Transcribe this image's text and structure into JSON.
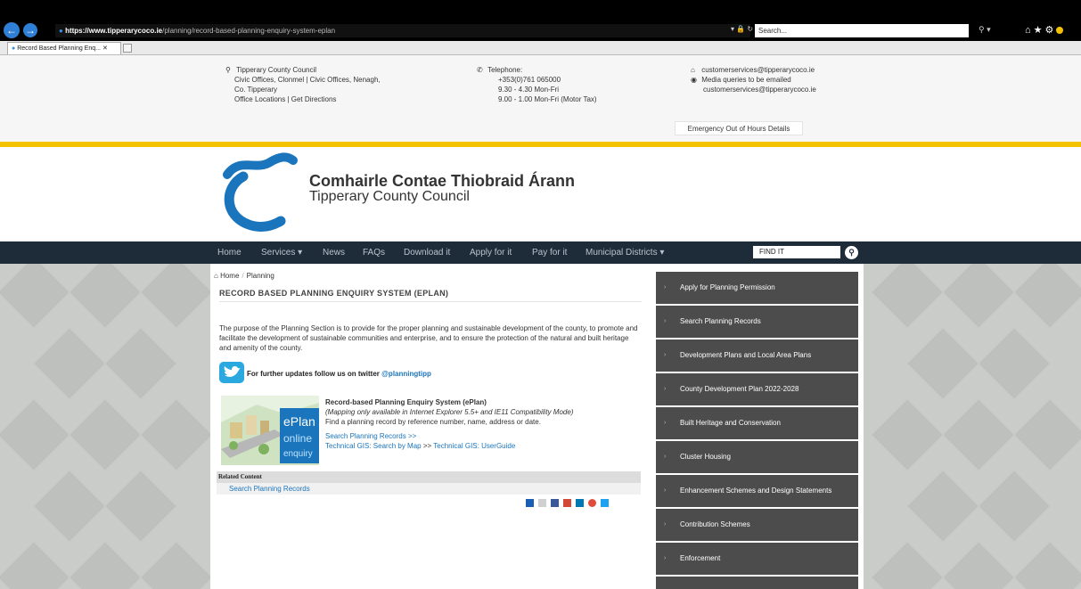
{
  "browser": {
    "url_domain": "https://www.tipperarycoco.ie",
    "url_path": "/planning/record-based-planning-enquiry-system-eplan",
    "search_placeholder": "Search...",
    "tab_title": "Record Based Planning Enq..."
  },
  "contact": {
    "address": [
      "Tipperary County Council",
      "Civic Offices, Clonmel | Civic Offices, Nenagh,",
      "Co. Tipperary",
      "Office Locations | Get Directions"
    ],
    "phone": [
      "Telephone:",
      "+353(0)761 065000",
      "9.30 - 4.30 Mon-Fri",
      "9.00 - 1.00 Mon-Fri (Motor Tax)"
    ],
    "email": "customerservices@tipperarycoco.ie",
    "media": [
      "Media queries to be emailed",
      "customerservices@tipperarycoco.ie"
    ],
    "emergency": "Emergency Out of Hours Details"
  },
  "logo": {
    "irish": "Comhairle Contae Thiobraid Árann",
    "english": "Tipperary County Council"
  },
  "nav": {
    "items": [
      "Home",
      "Services ▾",
      "News",
      "FAQs",
      "Download it",
      "Apply for it",
      "Pay for it",
      "Municipal Districts ▾"
    ],
    "find_it": "FIND IT"
  },
  "breadcrumb": [
    "Home",
    "Planning"
  ],
  "page": {
    "title": "RECORD BASED PLANNING ENQUIRY SYSTEM (EPLAN)",
    "intro": "The purpose of the Planning Section is to provide for the proper planning and sustainable development of the county, to promote and facilitate the development of sustainable communities and enterprise, and to ensure the protection of the natural and built heritage and amenity of the county.",
    "twitter_prefix": "For further updates follow us on twitter",
    "twitter_handle": "@planningtipp",
    "eplan_heading": "Record-based Planning Enquiry System (ePlan)",
    "eplan_note": "(Mapping only available in Internet Explorer 5.5+ and IE11 Compatibility Mode)",
    "eplan_desc": "Find a planning record by reference number, name, address or date.",
    "eplan_link1": "Search Planning Records >>",
    "eplan_link2": "Technical GIS: Search by Map",
    "eplan_link2_sep": ">>",
    "eplan_link3": "Technical GIS: UserGuide",
    "eplan_img_line1": "ePlan",
    "eplan_img_line2": "online",
    "eplan_img_line3": "enquiry",
    "related_heading": "Related Content",
    "related_link": "Search Planning Records"
  },
  "sidebar": {
    "items": [
      "Apply for Planning Permission",
      "Search Planning Records",
      "Development Plans and Local Area Plans",
      "County Development Plan 2022-2028",
      "Built Heritage and Conservation",
      "Cluster Housing",
      "Enhancement Schemes and Design Statements",
      "Contribution Schemes",
      "Enforcement"
    ]
  },
  "colors": {
    "nav_bg": "#1e2c3a",
    "accent_yellow": "#f2c400",
    "logo_blue": "#1b75bc",
    "sidebar_bg": "#4c4c4c"
  }
}
